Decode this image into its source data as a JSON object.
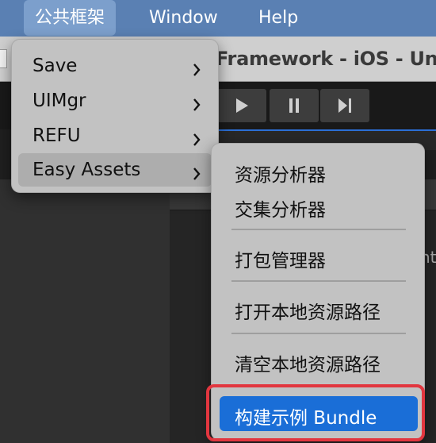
{
  "menubar": {
    "items": [
      "公共框架",
      "Window",
      "Help"
    ]
  },
  "window": {
    "title": "Framework - iOS - Uni"
  },
  "toolbar": {
    "play_icon": "play-icon",
    "pause_icon": "pause-icon",
    "step_icon": "step-icon"
  },
  "menu": {
    "items": [
      "Save",
      "UIMgr",
      "REFU",
      "Easy Assets"
    ],
    "highlighted": "Easy Assets"
  },
  "submenu": {
    "groups": [
      [
        "资源分析器",
        "交集分析器"
      ],
      [
        "打包管理器"
      ],
      [
        "打开本地资源路径"
      ],
      [
        "清空本地资源路径"
      ],
      [
        "构建示例 Bundle"
      ]
    ],
    "selected": "构建示例 Bundle"
  },
  "background": {
    "side_text": "ht"
  },
  "colors": {
    "menubar_bg": "#5a80b3",
    "menu_bg": "#c2c2c2",
    "selected_bg": "#1a6ed7",
    "highlight_frame": "#e2363f"
  }
}
